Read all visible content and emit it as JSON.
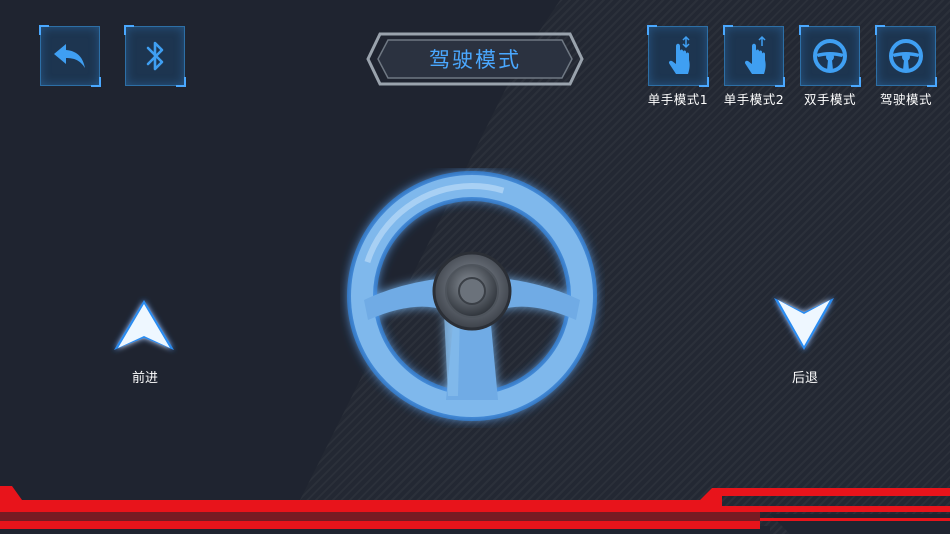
{
  "header": {
    "title": "驾驶模式",
    "back_icon": "back-arrow-icon",
    "bluetooth_icon": "bluetooth-icon"
  },
  "modes": [
    {
      "label": "单手模式1",
      "icon": "hand-swipe-icon"
    },
    {
      "label": "单手模式2",
      "icon": "hand-swipe-icon"
    },
    {
      "label": "双手模式",
      "icon": "steering-wheel-icon"
    },
    {
      "label": "驾驶模式",
      "icon": "steering-wheel-icon"
    }
  ],
  "controls": {
    "forward_label": "前进",
    "backward_label": "后退"
  },
  "colors": {
    "accent": "#4aa8ff",
    "background": "#1f2430",
    "alert_red": "#e8141b"
  }
}
